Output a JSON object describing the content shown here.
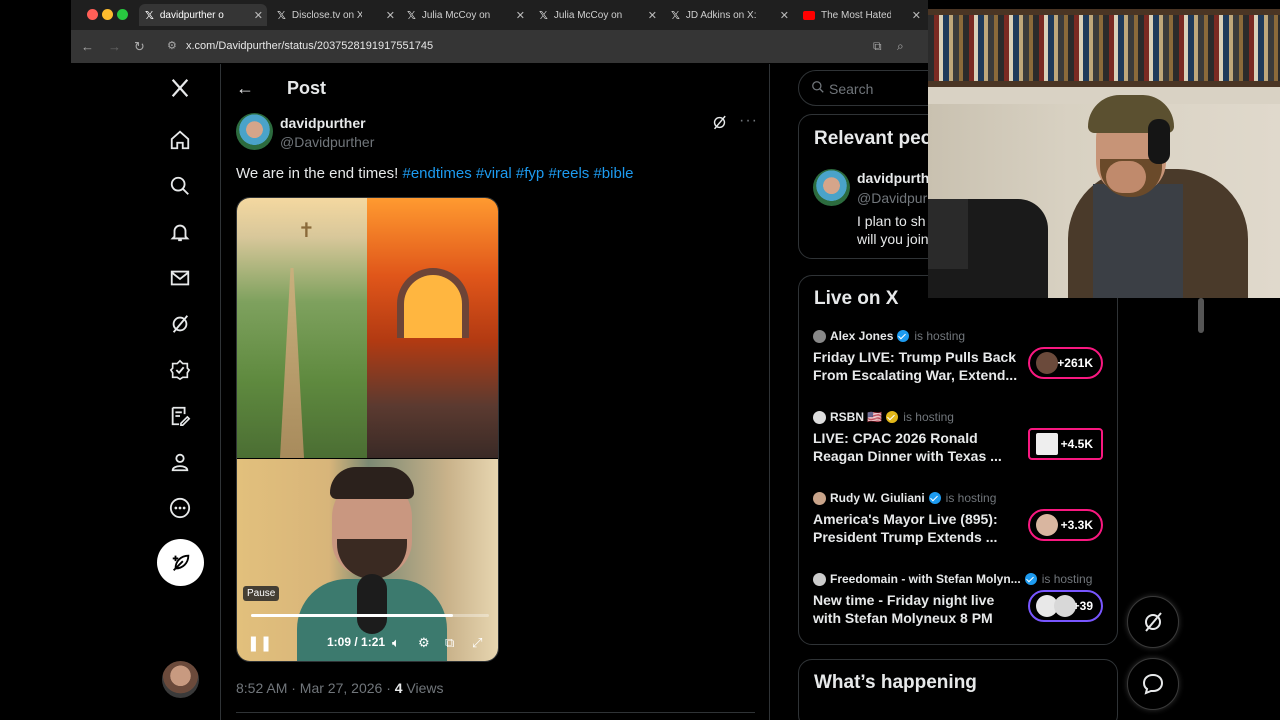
{
  "browser": {
    "tabs": [
      {
        "label": "davidpurther o",
        "icon": "x-logo-icon",
        "active": true
      },
      {
        "label": "Disclose.tv on X: \"",
        "icon": "x-logo-icon",
        "active": false
      },
      {
        "label": "Julia McCoy on X:",
        "icon": "x-logo-icon",
        "active": false
      },
      {
        "label": "Julia McCoy on X:",
        "icon": "x-logo-icon",
        "active": false
      },
      {
        "label": "JD Adkins on X: \"",
        "icon": "x-logo-icon",
        "active": false
      },
      {
        "label": "The Most Hated A",
        "icon": "youtube-icon",
        "active": false
      }
    ],
    "url": "x.com/Davidpurther/status/2037528191917551745"
  },
  "nav": {
    "items": [
      "home-icon",
      "search-icon",
      "notifications-icon",
      "messages-icon",
      "grok-icon",
      "premium-icon",
      "compose-list-icon",
      "profile-icon",
      "more-icon"
    ]
  },
  "main": {
    "title": "Post",
    "author": {
      "name": "davidpurther",
      "handle": "@Davidpurther"
    },
    "text": "We are in the end times!",
    "hashtags": [
      "#endtimes",
      "#viral",
      "#fyp",
      "#reels",
      "#bible"
    ],
    "video": {
      "tooltip": "Pause",
      "time": "1:09 / 1:21",
      "progress": 0.85
    },
    "meta": {
      "time": "8:52 AM · Mar 27, 2026 · ",
      "views": "4",
      "views_label": " Views"
    }
  },
  "right": {
    "search_placeholder": "Search",
    "relevant": {
      "title": "Relevant peo",
      "name": "davidpurth",
      "handle": "@Davidpur",
      "bio_line1": "I plan to sh",
      "bio_line2": "will you join"
    },
    "live": {
      "title": "Live on X",
      "items": [
        {
          "host": "Alex Jones",
          "badge": "blue",
          "hosting": "is hosting",
          "title": "Friday LIVE: Trump Pulls Back From Escalating War, Extend...",
          "listeners": "+261K"
        },
        {
          "host": "RSBN 🇺🇸",
          "badge": "gold",
          "hosting": "is hosting",
          "title": "LIVE: CPAC 2026 Ronald Reagan Dinner with Texas ...",
          "listeners": "+4.5K"
        },
        {
          "host": "Rudy W. Giuliani",
          "badge": "blue",
          "hosting": "is hosting",
          "title": "America's Mayor Live (895): President Trump Extends ...",
          "listeners": "+3.3K"
        },
        {
          "host": "Freedomain - with Stefan Molyn...",
          "badge": "blue",
          "hosting": "is hosting",
          "title": "New time - Friday night live with Stefan Molyneux 8 PM",
          "listeners": "+39"
        }
      ]
    },
    "happening": {
      "title": "What’s happening"
    }
  },
  "colors": {
    "accent": "#1d9bf0",
    "live_border": "#f91880",
    "live_border_alt": "#7856ff",
    "gold": "#e2b719"
  }
}
